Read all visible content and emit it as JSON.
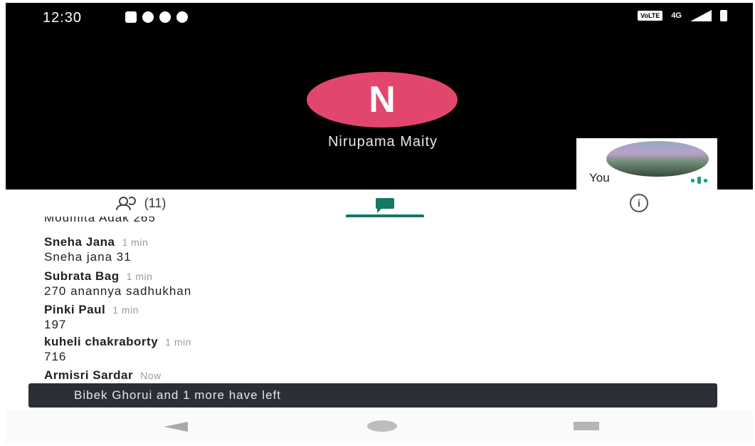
{
  "status_bar": {
    "time": "12:30",
    "network": "4G",
    "volte": "VoLTE",
    "icons": [
      "gallery-icon",
      "whatsapp-icon",
      "chat-bubble-icon",
      "message-icon"
    ]
  },
  "call": {
    "caller_initial": "N",
    "caller_name": "Nirupama Maity",
    "self_label": "You"
  },
  "tabs": {
    "people_count": "(11)",
    "active": "chat"
  },
  "messages": [
    {
      "sender": "Moumita Adak 265",
      "time": "",
      "text": ""
    },
    {
      "sender": "Sneha Jana",
      "time": "1 min",
      "text": "Sneha jana 31"
    },
    {
      "sender": "Subrata Bag",
      "time": "1 min",
      "text": "270 anannya sadhukhan"
    },
    {
      "sender": "Pinki Paul",
      "time": "1 min",
      "text": "197"
    },
    {
      "sender": "kuheli chakraborty",
      "time": "1 min",
      "text": "716"
    },
    {
      "sender": "Armisri Sardar",
      "time": "Now",
      "text": ""
    }
  ],
  "toast": "Bibek Ghorui and 1 more have left",
  "colors": {
    "accent": "#137a64",
    "avatar": "#e2466d"
  }
}
